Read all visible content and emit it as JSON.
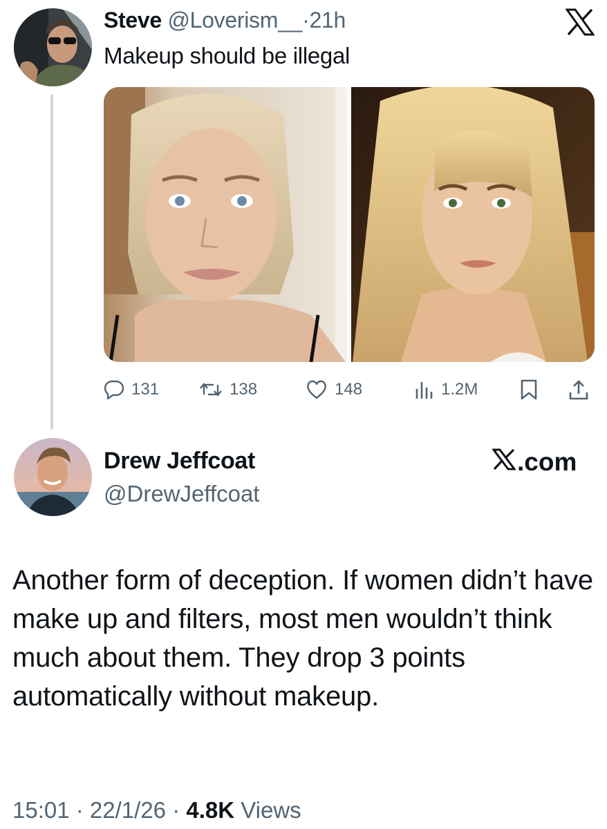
{
  "tweet1": {
    "display_name": "Steve",
    "handle": "@Loverism__",
    "separator": "·",
    "time": "21h",
    "text": "Makeup should be illegal",
    "logo_icon": "x-logo-icon",
    "stats": {
      "replies": "131",
      "reposts": "138",
      "likes": "148",
      "views": "1.2M"
    }
  },
  "tweet2": {
    "display_name": "Drew Jeffcoat",
    "handle": "@DrewJeffcoat",
    "site_label": ".com",
    "text": "Another form of deception. If women didn’t have make up and filters, most men wouldn’t think much about them. They drop 3 points automatically without makeup.",
    "meta": {
      "time": "15:01",
      "sep1": " · ",
      "date": "22/1/26",
      "sep2": " · ",
      "views_count": "4.8K",
      "views_label": " Views"
    }
  },
  "colors": {
    "text_primary": "#0f1419",
    "text_secondary": "#536471",
    "thread_line": "#cfd9de"
  }
}
